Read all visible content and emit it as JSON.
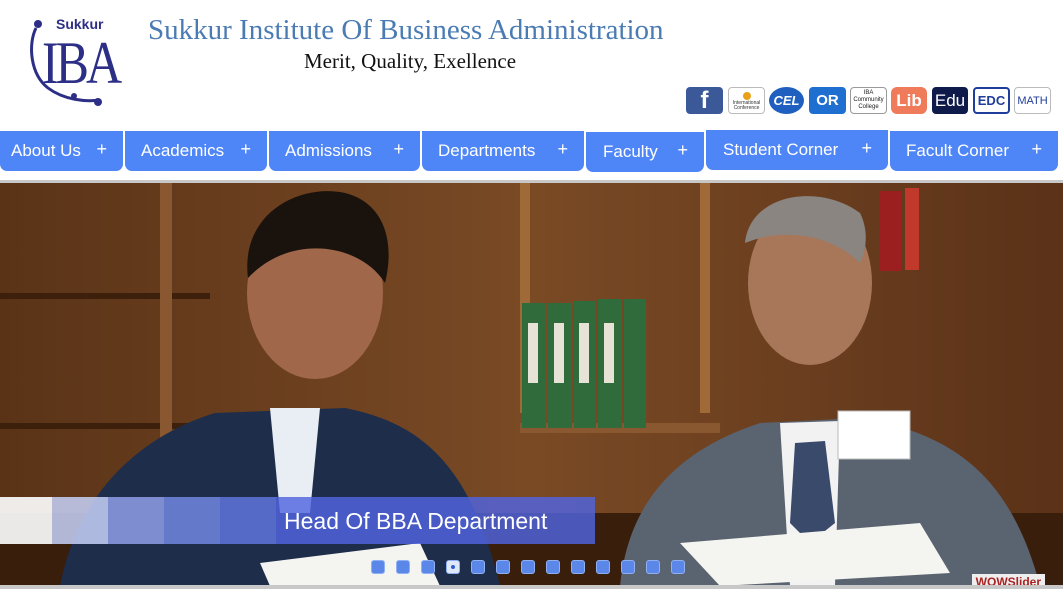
{
  "header": {
    "logo_small": "Sukkur",
    "logo_big": "IBA",
    "title": "Sukkur Institute Of Business Administration",
    "motto": "Merit, Quality, Exellence"
  },
  "quick_links": [
    {
      "name": "facebook",
      "label": "f",
      "bg": "#3b5998"
    },
    {
      "name": "international-conference",
      "label": "International Conference",
      "bg": "#ffffff"
    },
    {
      "name": "cel",
      "label": "CEL",
      "bg": "#1f5fbf"
    },
    {
      "name": "cor",
      "label": "OR",
      "bg": "#1f6fd0"
    },
    {
      "name": "community-college",
      "label": "IBA Community College",
      "bg": "#ffffff"
    },
    {
      "name": "lib",
      "label": "Lib",
      "bg": "#ef7b5b"
    },
    {
      "name": "edu",
      "label": "Edu",
      "bg": "#0e1a4a"
    },
    {
      "name": "edc",
      "label": "EDC",
      "bg": "#ffffff"
    },
    {
      "name": "math",
      "label": "MATH",
      "bg": "#ffffff"
    }
  ],
  "nav": [
    {
      "label": "About Us",
      "plus": "+"
    },
    {
      "label": "Academics",
      "plus": "+"
    },
    {
      "label": "Admissions",
      "plus": "+"
    },
    {
      "label": "Departments",
      "plus": "+"
    },
    {
      "label": "Faculty",
      "plus": "+"
    },
    {
      "label": "Student Corner",
      "plus": "+"
    },
    {
      "label": "Facult Corner",
      "plus": "+"
    }
  ],
  "slider": {
    "caption": "Head Of BBA Department",
    "slide_count": 13,
    "active_slide": 4,
    "watermark": "WOWSlider"
  },
  "colors": {
    "nav_bg": "#4f86f7",
    "title": "#4a7bb3",
    "logo": "#2d2f86"
  }
}
